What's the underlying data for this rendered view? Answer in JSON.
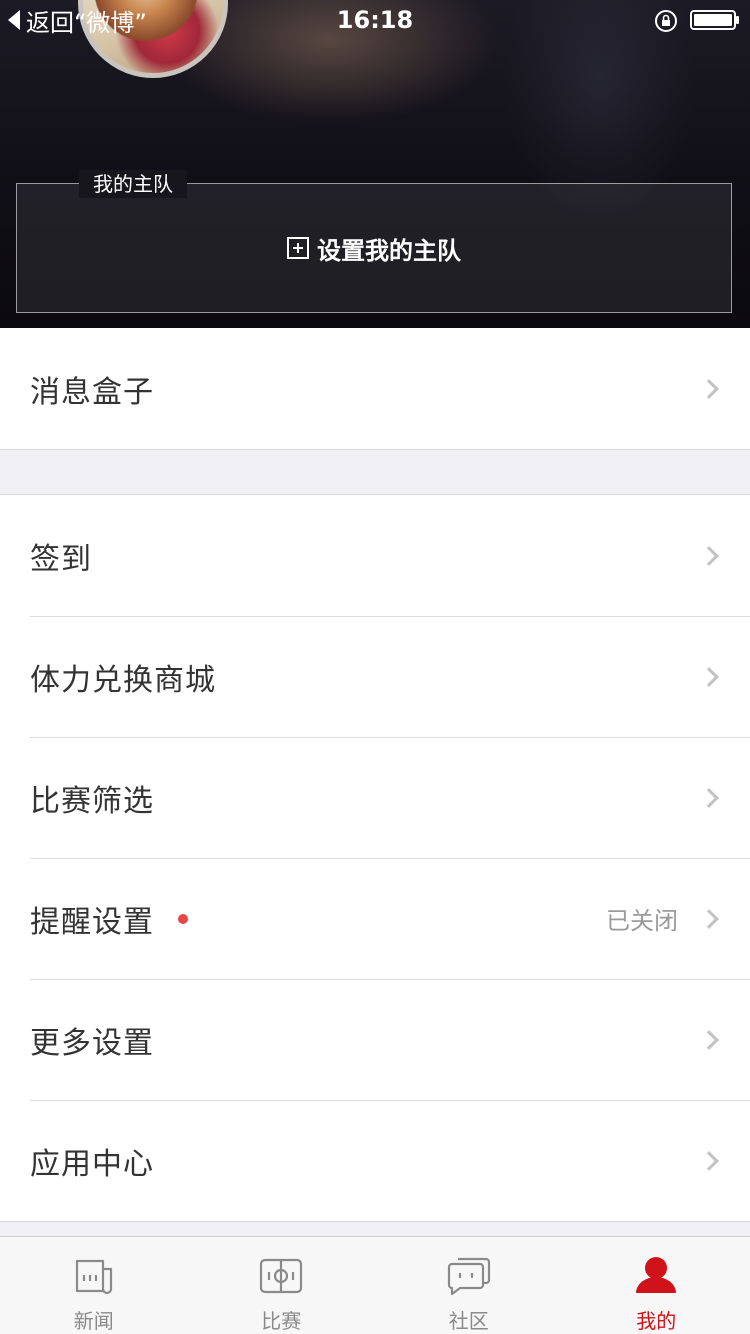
{
  "status_bar": {
    "back_label": "返回“微博”",
    "time": "16:18"
  },
  "header": {
    "team_legend": "我的主队",
    "set_team_label": "设置我的主队"
  },
  "menu": {
    "group1": [
      {
        "label": "消息盒子"
      }
    ],
    "group2": [
      {
        "label": "签到"
      },
      {
        "label": "体力兑换商城"
      },
      {
        "label": "比赛筛选"
      },
      {
        "label": "提醒设置",
        "value": "已关闭",
        "badge": true
      },
      {
        "label": "更多设置"
      },
      {
        "label": "应用中心"
      }
    ]
  },
  "tabbar": {
    "tabs": [
      {
        "label": "新闻",
        "icon": "news-icon"
      },
      {
        "label": "比赛",
        "icon": "match-icon"
      },
      {
        "label": "社区",
        "icon": "community-icon"
      },
      {
        "label": "我的",
        "icon": "profile-icon",
        "active": true
      }
    ]
  },
  "colors": {
    "accent": "#d0131a",
    "badge": "#e84545",
    "inactive": "#8a8a8a"
  }
}
